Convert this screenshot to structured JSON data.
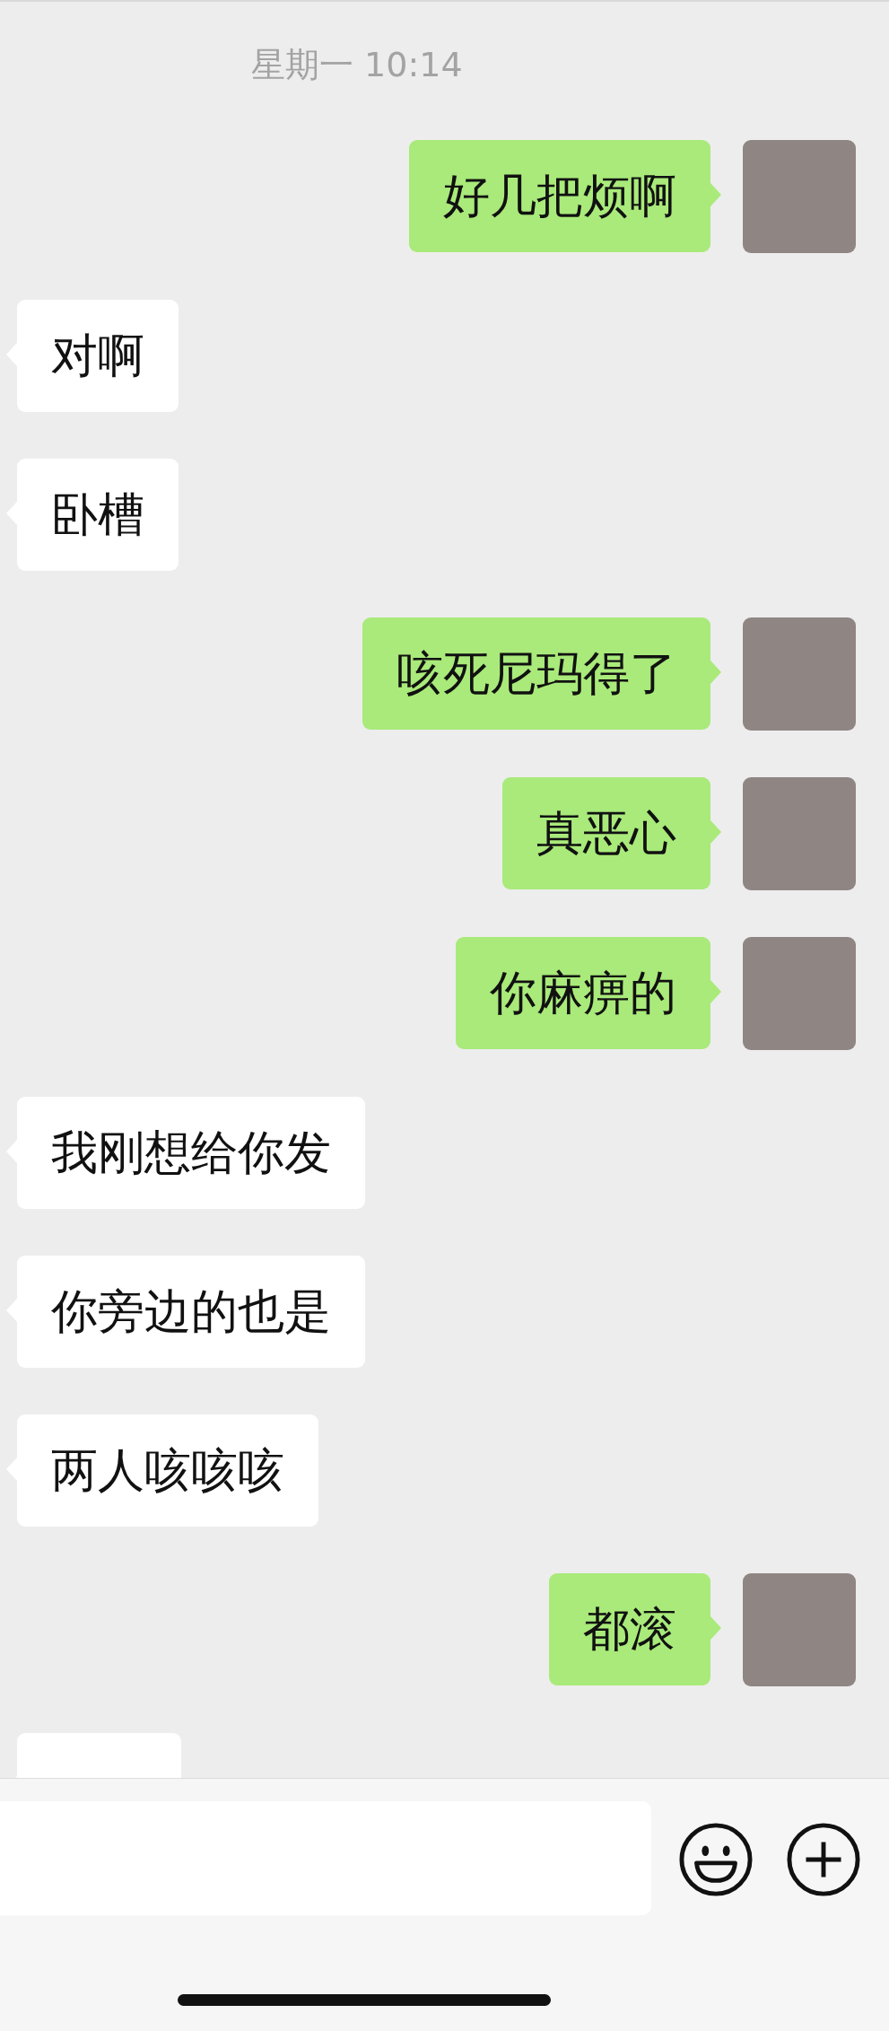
{
  "timestamp": "星期一 10:14",
  "messages": [
    {
      "kind": "sent",
      "text": "好几把烦啊"
    },
    {
      "kind": "received",
      "text": "对啊"
    },
    {
      "kind": "received",
      "text": "卧槽"
    },
    {
      "kind": "sent",
      "text": "咳死尼玛得了"
    },
    {
      "kind": "sent",
      "text": "真恶心"
    },
    {
      "kind": "sent",
      "text": "你麻痹的"
    },
    {
      "kind": "received",
      "text": "我刚想给你发"
    },
    {
      "kind": "received",
      "text": "你旁边的也是"
    },
    {
      "kind": "received",
      "text": "两人咳咳咳"
    },
    {
      "kind": "sent",
      "text": "都滚"
    },
    {
      "kind": "received"
    }
  ]
}
